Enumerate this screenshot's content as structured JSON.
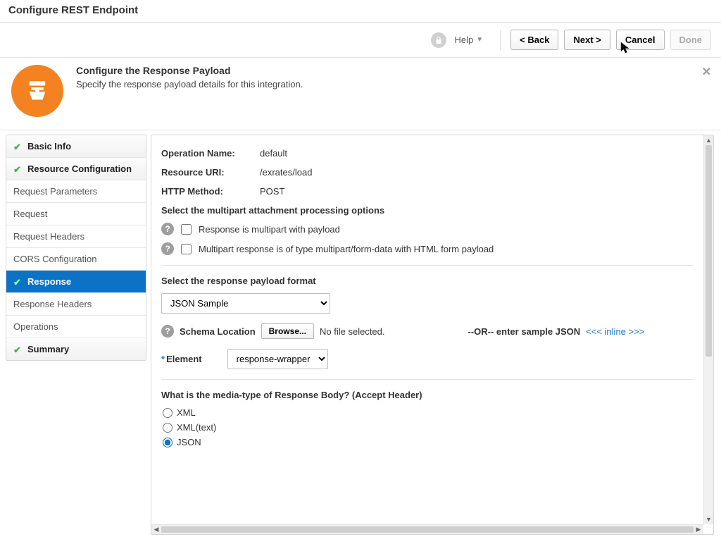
{
  "page": {
    "title": "Configure REST Endpoint"
  },
  "toolbar": {
    "help_label": "Help",
    "back_label": "< Back",
    "next_label": "Next >",
    "cancel_label": "Cancel",
    "done_label": "Done"
  },
  "banner": {
    "title": "Configure the Response Payload",
    "subtitle": "Specify the response payload details for this integration."
  },
  "sidebar": {
    "items": [
      {
        "label": "Basic Info",
        "state": "complete"
      },
      {
        "label": "Resource Configuration",
        "state": "complete"
      },
      {
        "label": "Request Parameters",
        "state": "none"
      },
      {
        "label": "Request",
        "state": "none"
      },
      {
        "label": "Request Headers",
        "state": "none"
      },
      {
        "label": "CORS Configuration",
        "state": "none"
      },
      {
        "label": "Response",
        "state": "active"
      },
      {
        "label": "Response Headers",
        "state": "none"
      },
      {
        "label": "Operations",
        "state": "none"
      },
      {
        "label": "Summary",
        "state": "complete"
      }
    ]
  },
  "main": {
    "operation_name_label": "Operation Name:",
    "operation_name_value": "default",
    "resource_uri_label": "Resource URI:",
    "resource_uri_value": "/exrates/load",
    "http_method_label": "HTTP Method:",
    "http_method_value": "POST",
    "multipart_section_label": "Select the multipart attachment processing options",
    "opt1_label": "Response is multipart with payload",
    "opt2_label": "Multipart response is of type multipart/form-data with HTML form payload",
    "payload_format_label": "Select the response payload format",
    "payload_format_value": "JSON Sample",
    "schema_location_label": "Schema Location",
    "browse_label": "Browse...",
    "no_file_label": "No file selected.",
    "or_label": "--OR-- enter sample JSON",
    "inline_link": "<<< inline >>>",
    "element_label": "Element",
    "element_value": "response-wrapper",
    "media_type_label": "What is the media-type of Response Body? (Accept Header)",
    "radio_xml": "XML",
    "radio_xml_text": "XML(text)",
    "radio_json": "JSON"
  }
}
